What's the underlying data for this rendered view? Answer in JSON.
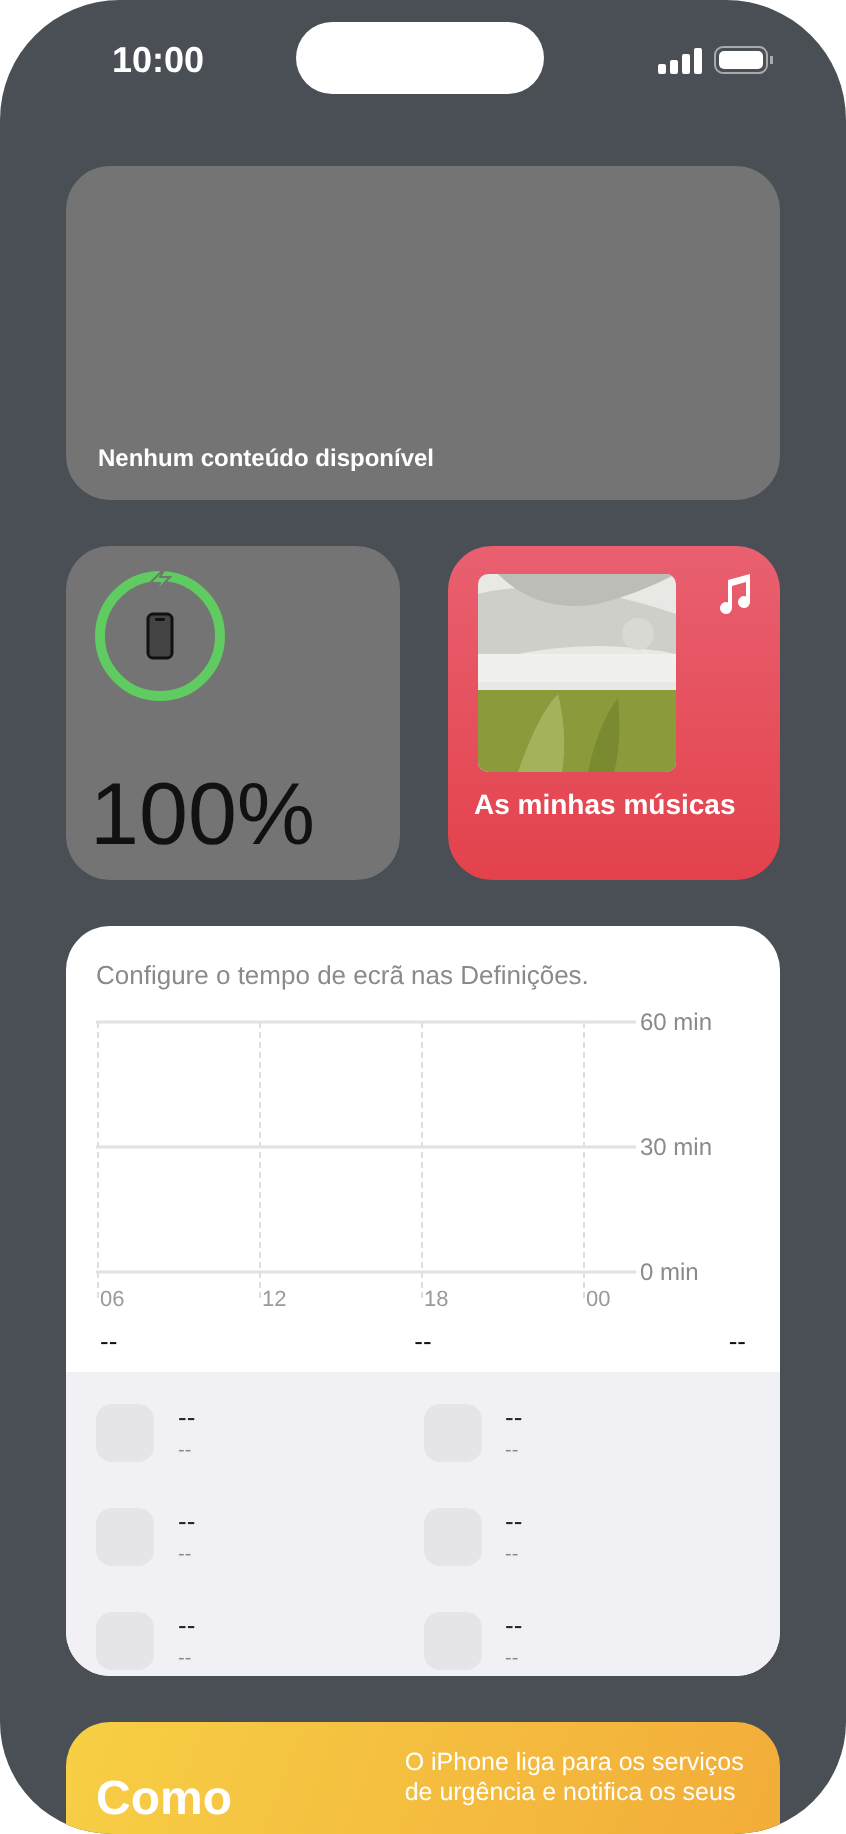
{
  "status_bar": {
    "time": "10:00"
  },
  "photos_widget": {
    "message": "Nenhum conteúdo disponível"
  },
  "battery_widget": {
    "level": 1,
    "charging": true,
    "percent": "100%"
  },
  "music_widget": {
    "title": "As minhas músicas"
  },
  "screen_time_widget": {
    "message": "Configure o tempo de ecrã nas Definições.",
    "chart_data": {
      "type": "bar",
      "categories": [
        "06",
        "12",
        "18",
        "00"
      ],
      "values": [
        null,
        null,
        null,
        null
      ],
      "yticks": [
        {
          "value": 0,
          "label": "0 min"
        },
        {
          "value": 30,
          "label": "30 min"
        },
        {
          "value": 60,
          "label": "60 min"
        }
      ],
      "ylim": [
        0,
        60
      ]
    },
    "totals": [
      "--",
      "--",
      "--"
    ],
    "apps": [
      {
        "name": "--",
        "time": "--"
      },
      {
        "name": "--",
        "time": "--"
      },
      {
        "name": "--",
        "time": "--"
      },
      {
        "name": "--",
        "time": "--"
      },
      {
        "name": "--",
        "time": "--"
      },
      {
        "name": "--",
        "time": "--"
      }
    ]
  },
  "emergency_widget": {
    "title": "Como",
    "text": "O iPhone liga para os serviços de urgência e notifica os seus"
  }
}
